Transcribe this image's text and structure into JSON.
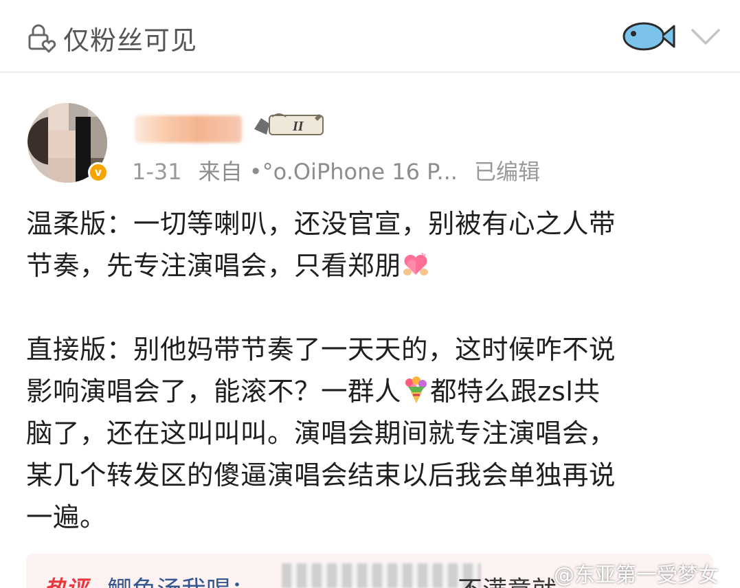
{
  "header": {
    "visibility_label": "仅粉丝可见",
    "lock_icon": "lock-heart-icon",
    "fish_icon": "fish-icon",
    "expand_icon": "chevron-down-icon"
  },
  "post": {
    "date": "1-31",
    "source": "来自 •°o.OiPhone 16 P...",
    "edited": "已编辑",
    "paragraph1_line1": "温柔版：一切等喇叭，还没官宣，别被有心之人带",
    "paragraph1_line2": "节奏，先专注演唱会，只看郑朋",
    "paragraph2_line1": "直接版：别他妈带节奏了一天天的，这时候咋不说",
    "paragraph2_line2a": "影响演唱会了，能滚不？一群人",
    "paragraph2_line2b": "都特么跟zsl共",
    "paragraph2_line3": "脑了，还在这叫叫叫。演唱会期间就专注演唱会，",
    "paragraph2_line4": "某几个转发区的傻逼演唱会结束以后我会单独再说",
    "paragraph2_line5": "一遍。"
  },
  "hot_comment": {
    "badge": "热评",
    "author": "鲫鱼汤我喝：",
    "text_tail": "不满意就"
  },
  "watermark": "@东亚第一受梦女",
  "colors": {
    "accent_blue": "#36568f",
    "hot_red": "#e8393f",
    "fish_blue": "#7cc3ec",
    "badge_orange": "#f7a400"
  }
}
